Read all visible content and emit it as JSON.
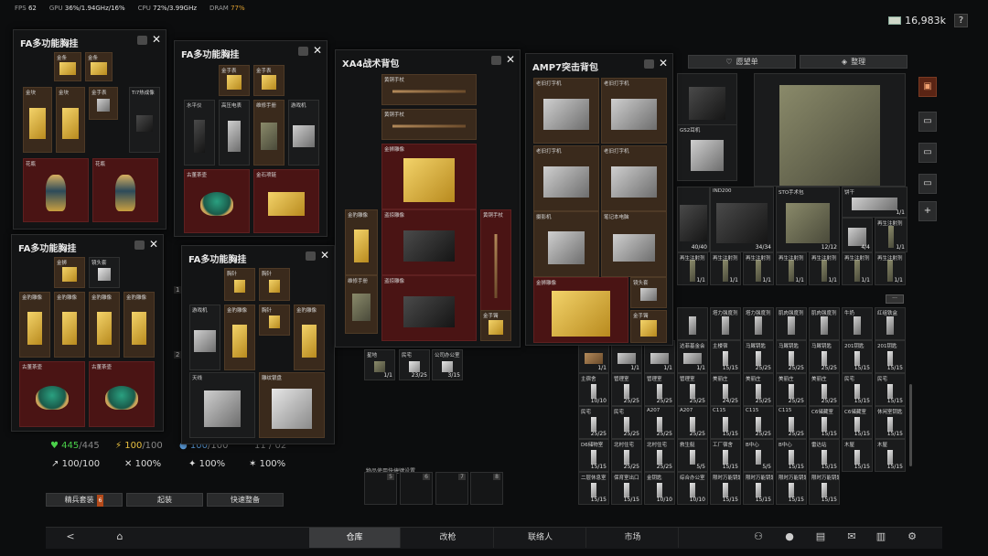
{
  "top_stats": {
    "fps_label": "FPS",
    "fps_value": "62",
    "gpu_label": "GPU",
    "gpu_value": "36%/1.94GHz/16%",
    "cpu_label": "CPU",
    "cpu_value": "72%/3.99GHz",
    "dram_label": "DRAM",
    "dram_value": "77%"
  },
  "money": "16,983k",
  "help_label": "?",
  "panels": {
    "p1": {
      "title": "FA多功能胸挂",
      "close": "✕"
    },
    "p2": {
      "title": "FA多功能胸挂",
      "close": "✕"
    },
    "p3": {
      "title": "FA多功能胸挂",
      "close": "✕"
    },
    "p4": {
      "title": "FA多功能胸挂",
      "close": "✕"
    },
    "p5": {
      "title": "XA4战术背包",
      "close": "✕"
    },
    "p6": {
      "title": "AMP7突击背包",
      "close": "✕"
    }
  },
  "cells": {
    "p1": [
      {
        "label": "金条",
        "count": ""
      },
      {
        "label": "金条",
        "count": ""
      },
      {
        "label": "金块",
        "count": ""
      },
      {
        "label": "金块",
        "count": ""
      },
      {
        "label": "金手表",
        "count": ""
      },
      {
        "label": "Ti7热成像",
        "count": ""
      },
      {
        "label": "花瓶",
        "count": ""
      },
      {
        "label": "花瓶",
        "count": ""
      }
    ],
    "p2": [
      {
        "label": "金手表",
        "count": ""
      },
      {
        "label": "金手表",
        "count": ""
      },
      {
        "label": "水平仪",
        "count": ""
      },
      {
        "label": "高压电表",
        "count": ""
      },
      {
        "label": "维修手册",
        "count": ""
      },
      {
        "label": "游戏机",
        "count": ""
      },
      {
        "label": "古董茶壶",
        "count": ""
      },
      {
        "label": "金石项链",
        "count": ""
      }
    ],
    "p3": [
      {
        "label": "金狮",
        "count": ""
      },
      {
        "label": "镜头套",
        "count": ""
      },
      {
        "label": "金豹雕像",
        "count": ""
      },
      {
        "label": "金豹雕像",
        "count": ""
      },
      {
        "label": "金豹雕像",
        "count": ""
      },
      {
        "label": "金豹雕像",
        "count": ""
      },
      {
        "label": "古董茶壶",
        "count": ""
      },
      {
        "label": "古董茶壶",
        "count": ""
      }
    ],
    "p4": [
      {
        "label": "胸针",
        "count": ""
      },
      {
        "label": "胸针",
        "count": ""
      },
      {
        "label": "游戏机",
        "count": ""
      },
      {
        "label": "金豹雕像",
        "count": ""
      },
      {
        "label": "胸针",
        "count": ""
      },
      {
        "label": "金豹雕像",
        "count": ""
      },
      {
        "label": "天线",
        "count": ""
      },
      {
        "label": "雕纹银盘",
        "count": ""
      }
    ],
    "p5": [
      {
        "label": "黄铜手杖",
        "count": ""
      },
      {
        "label": "黄铜手杖",
        "count": ""
      },
      {
        "label": "金狮雕像",
        "count": ""
      },
      {
        "label": "金豹雕像",
        "count": ""
      },
      {
        "label": "盗掠雕像",
        "count": ""
      },
      {
        "label": "黄铜手杖",
        "count": ""
      },
      {
        "label": "维修手册",
        "count": ""
      },
      {
        "label": "盗掠雕像",
        "count": ""
      },
      {
        "label": "金手镯",
        "count": ""
      }
    ],
    "p6": [
      {
        "label": "老旧打字机",
        "count": ""
      },
      {
        "label": "老旧打字机",
        "count": ""
      },
      {
        "label": "老旧打字机",
        "count": ""
      },
      {
        "label": "老旧打字机",
        "count": ""
      },
      {
        "label": "摄影机",
        "count": ""
      },
      {
        "label": "笔记本电脑",
        "count": ""
      },
      {
        "label": "金狮雕像",
        "count": ""
      },
      {
        "label": "镜头套",
        "count": ""
      },
      {
        "label": "金手镯",
        "count": ""
      }
    ],
    "under": [
      {
        "label": "星地",
        "count": "1/1"
      },
      {
        "label": "民宅",
        "count": "23/25"
      },
      {
        "label": "公司办公室",
        "count": "3/15"
      }
    ]
  },
  "stash": {
    "wishlist_label": "愿望单",
    "sort_label": "整理",
    "labels": {
      "gs2": "GS2耳机",
      "ind200": "IND200",
      "sto": "STO手术包",
      "snack": "饼干"
    },
    "counts": {
      "c1": "40/40",
      "c2": "34/34",
      "c3": "12/12",
      "c4": "1/1",
      "c5": "4/4"
    },
    "items_row": [
      {
        "label": "再生注射剂",
        "count": "1/1"
      },
      {
        "label": "再生注射剂",
        "count": "1/1"
      },
      {
        "label": "再生注射剂",
        "count": "1/1"
      },
      {
        "label": "再生注射剂",
        "count": "1/1"
      },
      {
        "label": "再生注射剂",
        "count": "1/1"
      },
      {
        "label": "再生注射剂",
        "count": "1/1"
      },
      {
        "label": "再生注射剂",
        "count": "1/1"
      }
    ],
    "keys_rows": [
      [
        {
          "label": "主楼宿",
          "count": "15/15"
        },
        {
          "label": "马厩钥匙",
          "count": "25/25"
        },
        {
          "label": "马厩钥匙",
          "count": "25/25"
        },
        {
          "label": "马厩钥匙",
          "count": "25/25"
        },
        {
          "label": "201钥匙",
          "count": "15/15"
        },
        {
          "label": "201钥匙",
          "count": "15/15"
        }
      ],
      [
        {
          "label": "主宿舍",
          "count": "10/10"
        },
        {
          "label": "管理室",
          "count": "25/25"
        },
        {
          "label": "管理室",
          "count": "25/25"
        },
        {
          "label": "管理室",
          "count": "25/25"
        },
        {
          "label": "美丽庄",
          "count": "24/25"
        },
        {
          "label": "美丽庄",
          "count": "25/25"
        },
        {
          "label": "美丽庄",
          "count": "25/25"
        },
        {
          "label": "美丽庄",
          "count": "25/25"
        },
        {
          "label": "民宅",
          "count": "15/15"
        },
        {
          "label": "民宅",
          "count": "15/15"
        }
      ],
      [
        {
          "label": "民宅",
          "count": "25/25"
        },
        {
          "label": "民宅",
          "count": "25/25"
        },
        {
          "label": "A207",
          "count": "25/25"
        },
        {
          "label": "A207",
          "count": "25/25"
        },
        {
          "label": "C115",
          "count": "15/15"
        },
        {
          "label": "C115",
          "count": "25/25"
        },
        {
          "label": "C115",
          "count": "25/25"
        },
        {
          "label": "C6储藏室",
          "count": "15/15"
        },
        {
          "label": "C6储藏室",
          "count": "15/15"
        },
        {
          "label": "休闲室钥匙",
          "count": "15/15"
        }
      ],
      [
        {
          "label": "D6储物室",
          "count": "15/15"
        },
        {
          "label": "北村住宅",
          "count": "25/25"
        },
        {
          "label": "北村住宅",
          "count": "25/25"
        },
        {
          "label": "救生艇",
          "count": "5/5"
        },
        {
          "label": "工厂宿舍",
          "count": "15/15"
        },
        {
          "label": "B中心",
          "count": "5/5"
        },
        {
          "label": "B中心",
          "count": "15/15"
        },
        {
          "label": "雷达站",
          "count": "15/15"
        },
        {
          "label": "木屋",
          "count": "15/15"
        },
        {
          "label": "木屋",
          "count": "15/15"
        }
      ],
      [
        {
          "label": "二层休息室",
          "count": "15/15"
        },
        {
          "label": "保育室出口",
          "count": "15/15"
        },
        {
          "label": "金钥匙",
          "count": "10/10"
        },
        {
          "label": "综合办公室",
          "count": "10/10"
        },
        {
          "label": "限时万能钥匙",
          "count": "15/15"
        },
        {
          "label": "限时万能钥匙",
          "count": "15/15"
        },
        {
          "label": "限时万能钥匙",
          "count": "15/15"
        },
        {
          "label": "限时万能钥匙",
          "count": "15/15"
        }
      ]
    ],
    "meds_row": [
      {
        "label": "",
        "count": ""
      },
      {
        "label": "塔力强度剂",
        "count": ""
      },
      {
        "label": "塔力强度剂",
        "count": ""
      },
      {
        "label": "肌肉强度剂",
        "count": ""
      },
      {
        "label": "肌肉强度剂",
        "count": ""
      },
      {
        "label": "牛奶",
        "count": ""
      },
      {
        "label": "红组铁盒",
        "count": ""
      }
    ],
    "misc_row": [
      {
        "label": "",
        "count": "1/1"
      },
      {
        "label": "",
        "count": "1/1"
      },
      {
        "label": "",
        "count": "1/1"
      },
      {
        "label": "达菲基金会",
        "count": "1/1"
      }
    ],
    "more_label": "···"
  },
  "char": {
    "health": "445",
    "health_max": "/445",
    "energy": "100",
    "energy_max": "/100",
    "water": "100",
    "water_max": "/100",
    "weight_partial": "11 / 02",
    "armor": "100/100",
    "stat2": "100%",
    "stat3": "100%",
    "stat4": "100%"
  },
  "loadout": {
    "btn1": "精兵套装",
    "btn1_badge": "6",
    "btn2": "起装",
    "btn3": "快速整备"
  },
  "hotkeys": {
    "title": "物品使用快捷键设置",
    "slots": [
      "5",
      "6",
      "7",
      "8"
    ]
  },
  "side_numbers": {
    "n1": "1",
    "n2": "2"
  },
  "nav": {
    "back": "<",
    "home": "⌂",
    "tabs": [
      "仓库",
      "改枪",
      "联络人",
      "市场"
    ]
  },
  "colors": {
    "accent_orange": "#b44a1a",
    "health_green": "#4ad04a",
    "energy_yellow": "#e8c040",
    "cell_red": "#4a1414"
  },
  "icons": [
    "eye-icon",
    "close-icon",
    "heart-icon",
    "sort-icon",
    "plus-icon",
    "home-icon",
    "back-icon",
    "friends-icon",
    "profile-icon",
    "chat-icon",
    "mail-icon",
    "notes-icon",
    "settings-icon",
    "money-icon",
    "help-icon"
  ]
}
